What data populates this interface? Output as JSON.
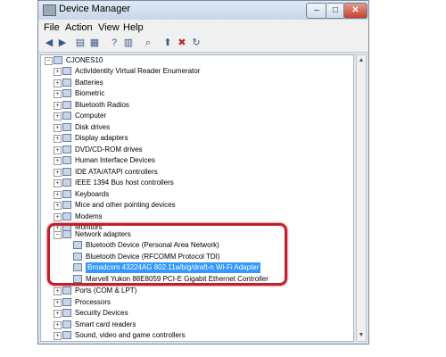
{
  "window": {
    "title": "Device Manager",
    "buttons": {
      "minimize": "–",
      "maximize": "□",
      "close": "✕"
    }
  },
  "menu": [
    "File",
    "Action",
    "View",
    "Help"
  ],
  "tree": {
    "root": "CJONES10",
    "categories": [
      "ActivIdentity Virtual Reader Enumerator",
      "Batteries",
      "Biometric",
      "Bluetooth Radios",
      "Computer",
      "Disk drives",
      "Display adapters",
      "DVD/CD-ROM drives",
      "Human Interface Devices",
      "IDE ATA/ATAPI controllers",
      "IEEE 1394 Bus host controllers",
      "Keyboards",
      "Mice and other pointing devices",
      "Modems",
      "Monitors"
    ],
    "network": {
      "label": "Network adapters",
      "items": [
        "Bluetooth Device (Personal Area Network)",
        "Bluetooth Device (RFCOMM Protocol TDI)",
        "Broadcom 43224AG 802.11a/b/g/draft-n Wi-Fi Adapter",
        "Marvell Yukon 88E8059 PCI-E Gigabit Ethernet Controller"
      ],
      "selected_index": 2
    },
    "after": [
      "Ports (COM & LPT)",
      "Processors",
      "Security Devices",
      "Smart card readers",
      "Sound, video and game controllers"
    ]
  },
  "colors": {
    "selection": "#3399ff",
    "highlight": "#c11f2d"
  }
}
